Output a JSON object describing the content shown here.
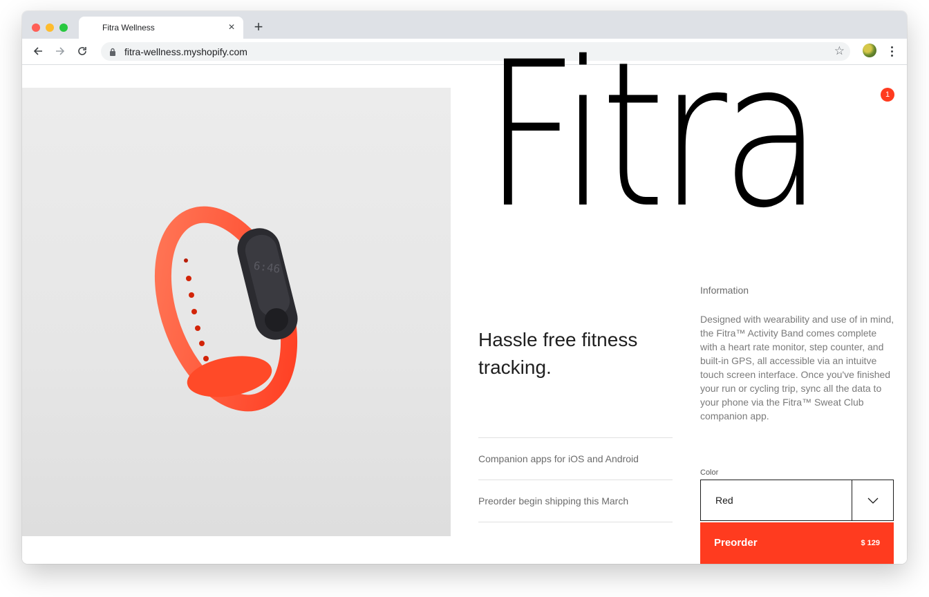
{
  "browser": {
    "tab_title": "Fitra Wellness",
    "tab_close": "×",
    "new_tab": "+",
    "url": "fitra-wellness.myshopify.com"
  },
  "store": {
    "brand": "Fitra",
    "cart_count": "1",
    "tagline": "Hassle free fitness tracking.",
    "features": [
      "Companion apps for iOS and Android",
      "Preorder begin shipping this March"
    ],
    "info": {
      "heading": "Information",
      "body": "Designed with wearability and use of in mind, the Fitra™ Activity Band comes complete with a heart rate monitor, step counter, and built-in GPS, all accessible via an intuitve touch screen interface. Once you've finished your run or cycling trip, sync all the data to your phone via the Fitra™ Sweat Club companion app."
    },
    "color": {
      "label": "Color",
      "selected": "Red"
    },
    "preorder": {
      "label": "Preorder",
      "price": "$ 129"
    },
    "band_time": "6:46"
  },
  "colors": {
    "accent": "#ff3b1f",
    "band": "#ff5a3a",
    "chrome_bg": "#dee1e6"
  },
  "icons": [
    "back-arrow-icon",
    "forward-arrow-icon",
    "reload-icon",
    "lock-icon",
    "star-icon",
    "chevron-down-icon"
  ]
}
